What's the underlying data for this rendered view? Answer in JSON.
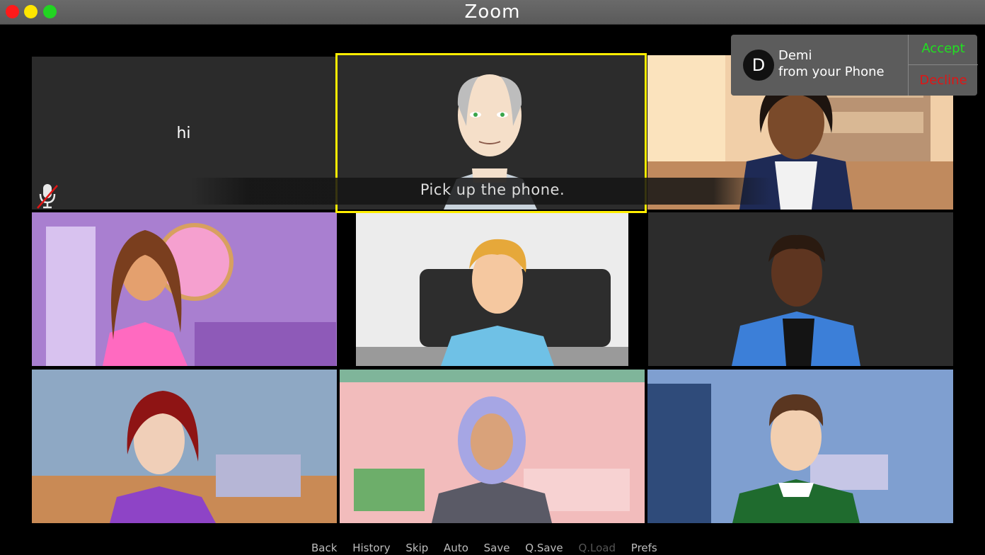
{
  "window": {
    "title": "Zoom"
  },
  "tiles": {
    "self": {
      "text": "hi",
      "mic_state": "muted"
    }
  },
  "dialogue": {
    "text": "Pick up the phone."
  },
  "incoming_call": {
    "avatar_letter": "D",
    "caller_name": "Demi",
    "caller_source": "from your Phone",
    "accept_label": "Accept",
    "decline_label": "Decline"
  },
  "quick_menu": {
    "back": "Back",
    "history": "History",
    "skip": "Skip",
    "auto": "Auto",
    "save": "Save",
    "qsave": "Q.Save",
    "qload": "Q.Load",
    "prefs": "Prefs"
  },
  "colors": {
    "accent_selected": "#ffee00",
    "accept": "#20e020",
    "decline": "#e01515"
  }
}
